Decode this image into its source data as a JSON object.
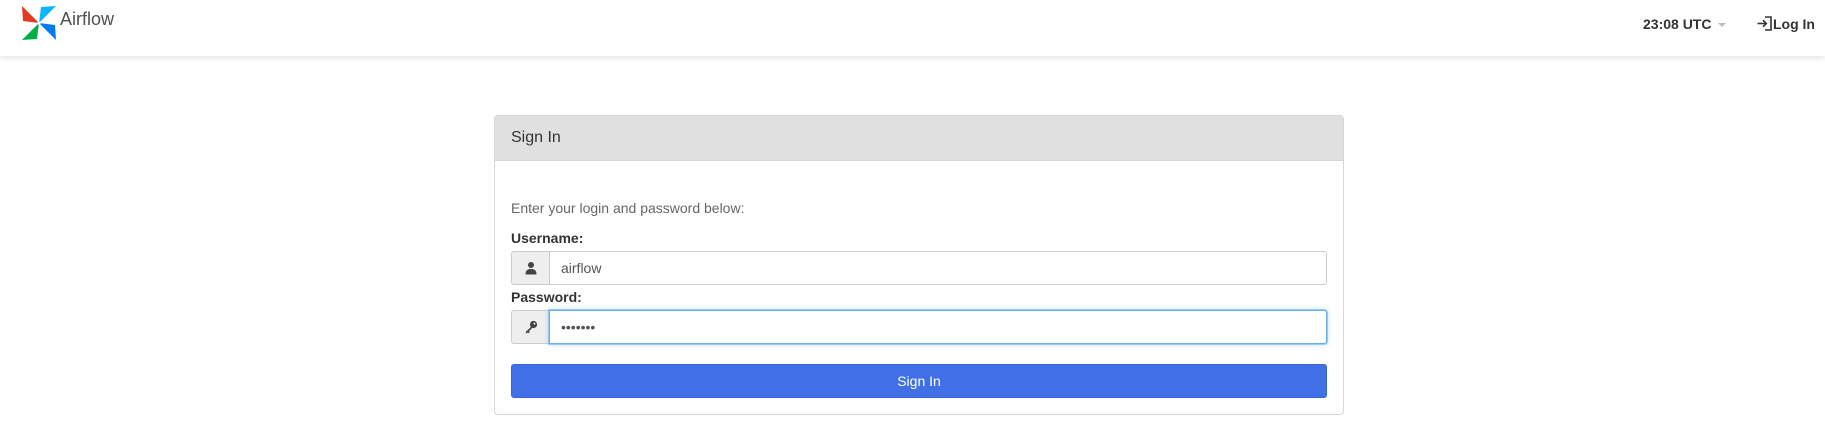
{
  "navbar": {
    "brand_name": "Airflow",
    "clock": "23:08 UTC",
    "login_label": "Log In"
  },
  "signin": {
    "title": "Sign In",
    "instructions": "Enter your login and password below:",
    "username_label": "Username:",
    "username_value": "airflow",
    "password_label": "Password:",
    "password_value": "airflow",
    "submit_label": "Sign In"
  },
  "icons": {
    "brand": "airflow-logo-icon",
    "login": "sign-in-icon",
    "user": "user-icon",
    "password": "key-icon"
  },
  "colors": {
    "primary_button": "#4170e6",
    "panel_heading": "#e0e0e0",
    "focus_border": "#66afe9",
    "logo_teal": "#00ad46",
    "logo_blue": "#0cb6ff",
    "logo_red": "#e43921",
    "logo_dark_blue": "#017cee"
  }
}
